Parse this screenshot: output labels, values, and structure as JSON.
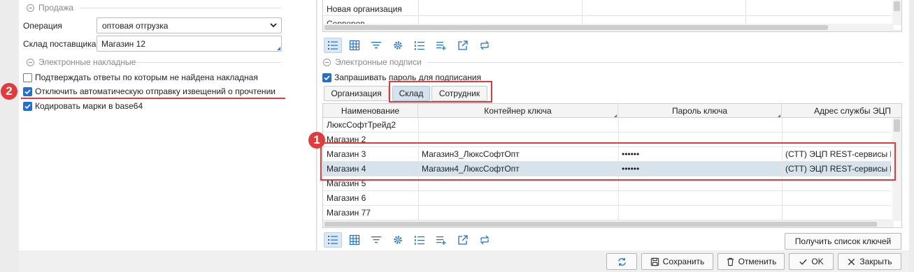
{
  "sale": {
    "group_title": "Продажа",
    "operation_label": "Операция",
    "operation_value": "оптовая отгрузка",
    "warehouse_label": "Склад поставщика",
    "warehouse_value": "Магазин 12"
  },
  "e_invoices": {
    "group_title": "Электронные накладные",
    "options": [
      {
        "label": "Подтверждать ответы по которым не найдена накладная",
        "checked": false
      },
      {
        "label": "Отключить автоматическую отправку извещений о прочтении",
        "checked": true
      },
      {
        "label": "Кодировать марки в base64",
        "checked": true
      }
    ]
  },
  "orgs_grid": {
    "rows": [
      "Новая организация",
      "Серверов"
    ]
  },
  "e_signatures": {
    "group_title": "Электронные подписи",
    "ask_password_label": "Запрашивать пароль для подписания",
    "ask_password_checked": true,
    "tabs": [
      "Организация",
      "Склад",
      "Сотрудник"
    ],
    "active_tab": "Склад",
    "columns": [
      "Наименование",
      "Контейнер ключа",
      "Пароль ключа",
      "Адрес службы ЭЦП"
    ],
    "rows": [
      {
        "name": "ЛюксСофтТрейд2",
        "container": "",
        "password": "",
        "service": ""
      },
      {
        "name": "Магазин 2",
        "container": "",
        "password": "",
        "service": ""
      },
      {
        "name": "Магазин 3",
        "container": "Магазин3_ЛюксСофтОпт",
        "password": "••••••",
        "service": "(СТТ) ЭЦП REST-сервисы loc"
      },
      {
        "name": "Магазин 4",
        "container": "Магазин4_ЛюксСофтОпт",
        "password": "••••••",
        "service": "(СТТ) ЭЦП REST-сервисы loc"
      },
      {
        "name": "Магазин 5",
        "container": "",
        "password": "",
        "service": ""
      },
      {
        "name": "Магазин 6",
        "container": "",
        "password": "",
        "service": ""
      },
      {
        "name": "Магазин 77",
        "container": "",
        "password": "",
        "service": ""
      }
    ],
    "selected_row": "Магазин 4",
    "get_keys_button": "Получить список ключей"
  },
  "annotations": {
    "badge1": "1",
    "badge2": "2"
  },
  "footer": {
    "refresh_icon": "refresh-icon",
    "save": "Сохранить",
    "cancel": "Отменить",
    "ok": "OK",
    "close": "Закрыть"
  },
  "colors": {
    "accent": "#1e6fd9",
    "annotation_red": "#e33b3b",
    "selected_row": "#d6e3ea"
  }
}
